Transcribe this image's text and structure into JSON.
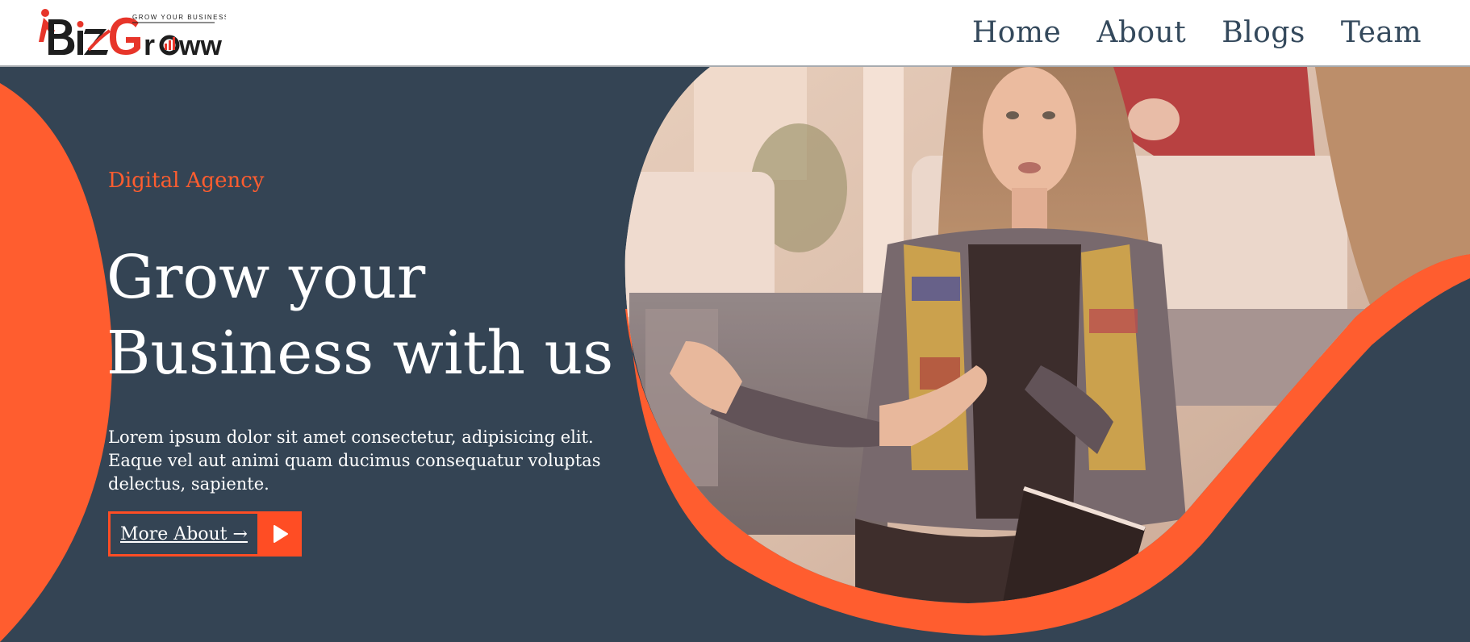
{
  "header": {
    "logo": {
      "brand_part1": "Biz",
      "brand_part2": "Grow",
      "tagline": "GROW YOUR BUSINESS",
      "accent_color": "#e7352a",
      "dark_color": "#1e1e1e"
    },
    "nav": [
      {
        "label": "Home"
      },
      {
        "label": "About"
      },
      {
        "label": "Blogs"
      },
      {
        "label": "Team"
      }
    ]
  },
  "hero": {
    "eyebrow": "Digital Agency",
    "headline_line1": "Grow your",
    "headline_line2": "Business with us",
    "description": "Lorem ipsum dolor sit amet consectetur, adipisicing elit. Eaque vel aut animi quam ducimus consequatur voluptas delectus, sapiente.",
    "cta_label": "More About →",
    "play_icon": "play-icon",
    "colors": {
      "background": "#344454",
      "accent": "#ff5d2f",
      "text": "#ffffff"
    }
  }
}
